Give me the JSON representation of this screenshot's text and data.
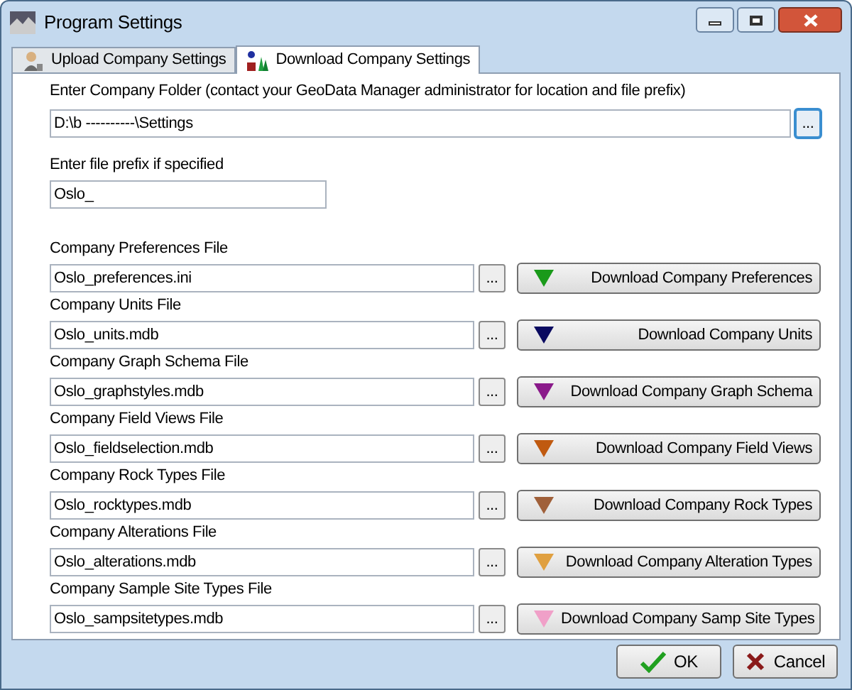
{
  "window": {
    "title": "Program Settings"
  },
  "tabs": [
    {
      "label": "Upload Company Settings",
      "selected": false
    },
    {
      "label": "Download Company Settings",
      "selected": true
    }
  ],
  "folder": {
    "label": "Enter Company Folder (contact your GeoData Manager administrator for location and file prefix)",
    "value": "D:\\b ----------\\Settings",
    "browse": "..."
  },
  "prefix": {
    "label": "Enter file prefix if specified",
    "value": "Oslo_"
  },
  "files": [
    {
      "label": "Company Preferences File",
      "value": "Oslo_preferences.ini",
      "browse": "...",
      "button": "Download Company Preferences",
      "color": "#1a9a1a"
    },
    {
      "label": "Company Units File",
      "value": "Oslo_units.mdb",
      "browse": "...",
      "button": "Download Company Units",
      "color": "#0a0a60"
    },
    {
      "label": "Company Graph Schema File",
      "value": "Oslo_graphstyles.mdb",
      "browse": "...",
      "button": "Download Company Graph Schema",
      "color": "#8a1a8a"
    },
    {
      "label": "Company Field Views File",
      "value": "Oslo_fieldselection.mdb",
      "browse": "...",
      "button": "Download Company Field Views",
      "color": "#c05a10"
    },
    {
      "label": "Company Rock Types File",
      "value": "Oslo_rocktypes.mdb",
      "browse": "...",
      "button": "Download Company Rock Types",
      "color": "#a0603a"
    },
    {
      "label": "Company Alterations File",
      "value": "Oslo_alterations.mdb",
      "browse": "...",
      "button": "Download Company Alteration Types",
      "color": "#e0a040"
    },
    {
      "label": "Company Sample Site Types File",
      "value": "Oslo_sampsitetypes.mdb",
      "browse": "...",
      "button": "Download Company Samp Site Types",
      "color": "#f0a0c8"
    }
  ],
  "buttons": [
    {
      "kind": "ok",
      "label": "OK"
    },
    {
      "kind": "cancel",
      "label": "Cancel"
    }
  ]
}
